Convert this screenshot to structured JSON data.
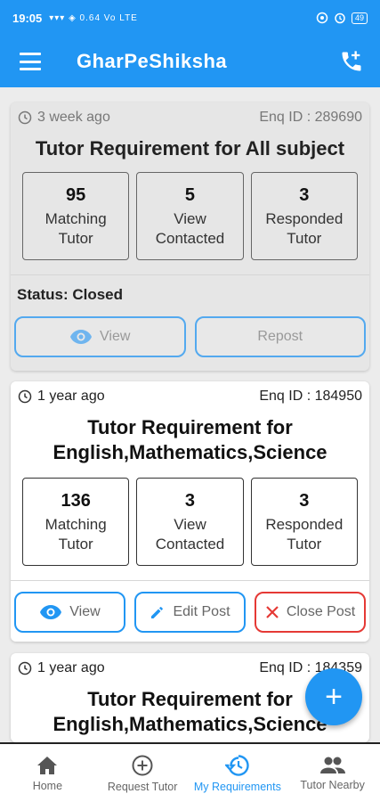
{
  "status_bar": {
    "time": "19:05",
    "signals": "▾▾▾ ◈ 0.64 Vo LTE",
    "battery": "49"
  },
  "app_bar": {
    "title": "GharPeShiksha",
    "menu_icon": "menu-icon",
    "phone_icon": "phone-forward-icon"
  },
  "cards": [
    {
      "time": "3 week ago",
      "enq": "Enq ID : 289690",
      "title": "Tutor Requirement for All subject",
      "stats": [
        {
          "num": "95",
          "l1": "Matching",
          "l2": "Tutor"
        },
        {
          "num": "5",
          "l1": "View",
          "l2": "Contacted"
        },
        {
          "num": "3",
          "l1": "Responded",
          "l2": "Tutor"
        }
      ],
      "status": "Status: Closed",
      "view_label": "View",
      "repost_label": "Repost"
    },
    {
      "time": "1 year ago",
      "enq": "Enq ID : 184950",
      "title_line1": "Tutor Requirement for",
      "title_line2": "English,Mathematics,Science",
      "stats": [
        {
          "num": "136",
          "l1": "Matching",
          "l2": "Tutor"
        },
        {
          "num": "3",
          "l1": "View",
          "l2": "Contacted"
        },
        {
          "num": "3",
          "l1": "Responded",
          "l2": "Tutor"
        }
      ],
      "view_label": "View",
      "edit_label": "Edit Post",
      "close_label": "Close Post"
    },
    {
      "time": "1 year ago",
      "enq": "Enq ID : 184359",
      "title_line1": "Tutor Requirement for",
      "title_line2": "English,Mathematics,Science"
    }
  ],
  "fab": {
    "label": "+"
  },
  "nav": [
    {
      "label": "Home",
      "active": false
    },
    {
      "label": "Request Tutor",
      "active": false
    },
    {
      "label": "My Requirements",
      "active": true
    },
    {
      "label": "Tutor Nearby",
      "active": false
    }
  ],
  "colors": {
    "primary": "#2196f3",
    "danger": "#e53935"
  }
}
